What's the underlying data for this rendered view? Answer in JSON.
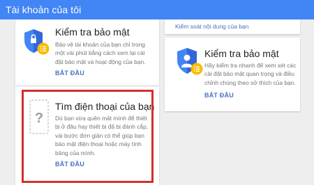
{
  "header": {
    "title": "Tài khoản của tôi"
  },
  "security_check_left": {
    "title": "Kiểm tra bảo mật",
    "description_lines": [
      "Bảo vệ tài khoản của bạn chỉ trong",
      "một vài phút bằng cách xem lại cài",
      "đặt bảo mật và hoạt động của bạn."
    ],
    "action": "BẮT ĐẦU"
  },
  "find_phone": {
    "title": "Tìm điện thoại của bạn",
    "description_lines": [
      "Dù bạn vừa quên mất mình để thiết",
      "bị ở đâu hay thiết bị đã bị đánh cắp,",
      "vài bước đơn giản có thể giúp bạn",
      "bảo mật điện thoại hoặc máy tính",
      "bảng của mình."
    ],
    "action": "BẮT ĐẦU"
  },
  "content_control": {
    "link": "Kiểm soát nội dung của bạn"
  },
  "security_check_right": {
    "title": "Kiểm tra bảo mật",
    "description_lines": [
      "Hãy kiểm tra nhanh để xem xét các",
      "cài đặt bảo mật quan trọng và điều",
      "chỉnh chúng theo sở thích của bạn."
    ],
    "action": "BẮT ĐẦU"
  },
  "colors": {
    "header_blue": "#4285f4",
    "link_blue": "#4a6fc4",
    "highlight_red": "#d32f2f",
    "shield_blue": "#4285f4",
    "badge_yellow": "#fbbc04"
  },
  "icons": [
    "shield-list-icon",
    "phone-question-icon",
    "user-shield-list-icon"
  ]
}
